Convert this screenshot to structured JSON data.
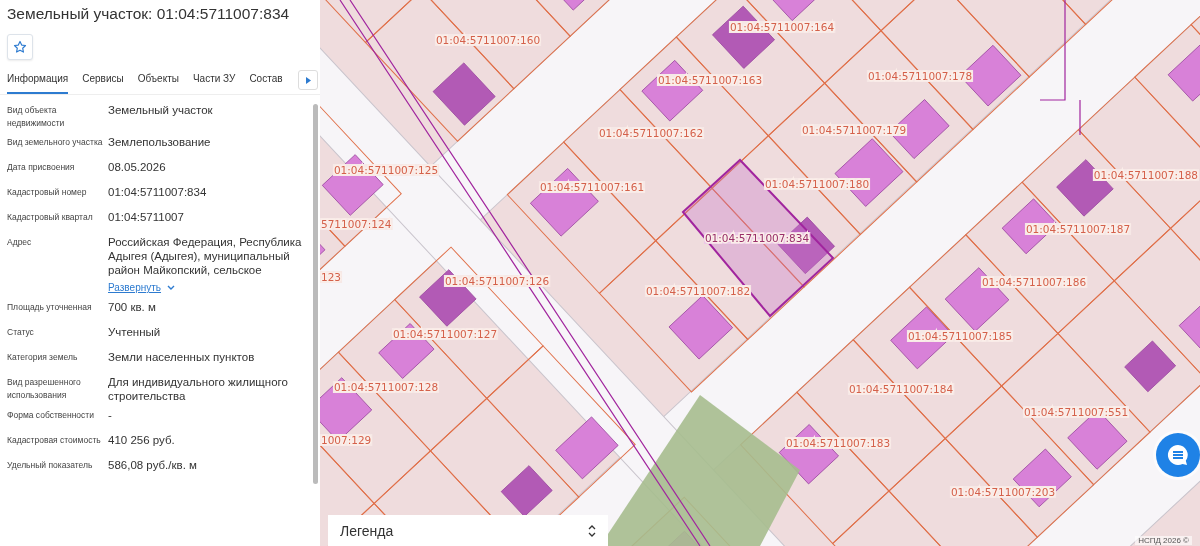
{
  "title": "Земельный участок: 01:04:5711007:834",
  "tabs": [
    {
      "label": "Информация",
      "selected": true
    },
    {
      "label": "Сервисы",
      "selected": false
    },
    {
      "label": "Объекты",
      "selected": false
    },
    {
      "label": "Части ЗУ",
      "selected": false
    },
    {
      "label": "Состав",
      "selected": false
    }
  ],
  "fields": [
    {
      "label": "Вид объекта недвижимости",
      "value": "Земельный участок"
    },
    {
      "label": "Вид земельного участка",
      "value": "Землепользование"
    },
    {
      "label": "Дата присвоения",
      "value": "08.05.2026"
    },
    {
      "label": "Кадастровый номер",
      "value": "01:04:5711007:834"
    },
    {
      "label": "Кадастровый квартал",
      "value": "01:04:5711007"
    },
    {
      "label": "Адрес",
      "value": "Российская Федерация, Республика Адыгея (Адыгея), муниципальный район Майкопский, сельское",
      "expand_link": "Развернуть"
    },
    {
      "label": "Площадь уточненная",
      "value": "700 кв. м"
    },
    {
      "label": "Статус",
      "value": "Учтенный"
    },
    {
      "label": "Категория земель",
      "value": "Земли населенных пунктов"
    },
    {
      "label": "Вид разрешенного использования",
      "value": "Для индивидуального жилищного строительства"
    },
    {
      "label": "Форма собственности",
      "value": "-"
    },
    {
      "label": "Кадастровая стоимость",
      "value": "410 256 руб."
    },
    {
      "label": "Удельный показатель",
      "value": "586,08 руб./кв. м"
    }
  ],
  "map": {
    "parcel_labels": [
      {
        "text": "01:04:5711007:160",
        "selected": false
      },
      {
        "text": "01:04:5711007:164",
        "selected": false
      },
      {
        "text": "01:04:5711007:163",
        "selected": false
      },
      {
        "text": "01:04:5711007:178",
        "selected": false
      },
      {
        "text": "01:04:5711007:162",
        "selected": false
      },
      {
        "text": "01:04:5711007:179",
        "selected": false
      },
      {
        "text": "01:04:5711007:125",
        "selected": false
      },
      {
        "text": "01:04:5711007:161",
        "selected": false
      },
      {
        "text": "01:04:5711007:180",
        "selected": false
      },
      {
        "text": "01:04:5711007:188",
        "selected": false
      },
      {
        "text": "5711007:124",
        "selected": false
      },
      {
        "text": "01:04:5711007:834",
        "selected": true
      },
      {
        "text": "01:04:5711007:187",
        "selected": false
      },
      {
        "text": "123",
        "selected": false
      },
      {
        "text": "01:04:5711007:126",
        "selected": false
      },
      {
        "text": "01:04:5711007:182",
        "selected": false
      },
      {
        "text": "01:04:5711007:186",
        "selected": false
      },
      {
        "text": "01:04:5711007:127",
        "selected": false
      },
      {
        "text": "01:04:5711007:185",
        "selected": false
      },
      {
        "text": "01:04:5711007:128",
        "selected": false
      },
      {
        "text": "01:04:5711007:184",
        "selected": false
      },
      {
        "text": "01:04:5711007:551",
        "selected": false
      },
      {
        "text": "1007:129",
        "selected": false
      },
      {
        "text": "01:04:5711007:183",
        "selected": false
      },
      {
        "text": "01:04:5711007:203",
        "selected": false
      }
    ],
    "attribution": "НСПД 2026 ©"
  },
  "legend": {
    "label": "Легенда"
  }
}
